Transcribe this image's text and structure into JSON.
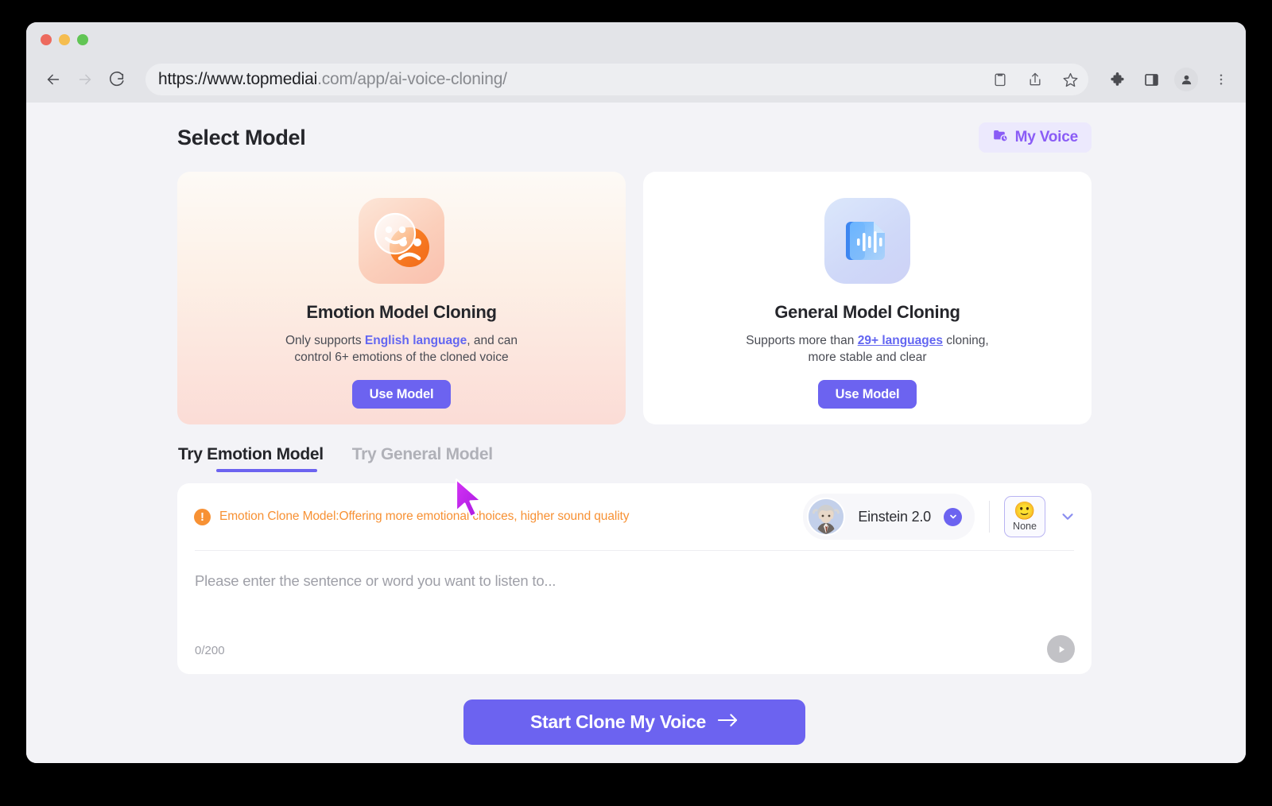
{
  "browser": {
    "url_bold": "https://www.topmediai",
    "url_rest": ".com/app/ai-voice-cloning/",
    "nav": {
      "back": "back-arrow",
      "forward": "forward-arrow",
      "reload": "reload-icon"
    },
    "toolbar_icons": [
      "clipboard-icon",
      "share-icon",
      "bookmark-star-icon",
      "extensions-puzzle-icon",
      "side-panel-icon",
      "profile-icon",
      "more-menu-icon"
    ],
    "window_controls": [
      "close",
      "minimize",
      "maximize"
    ]
  },
  "header": {
    "title": "Select Model",
    "my_voice_label": "My Voice"
  },
  "cards": [
    {
      "id": "emotion",
      "icon": "emotion-faces-icon",
      "title": "Emotion Model Cloning",
      "desc_pre": "Only supports ",
      "desc_highlight": "English language",
      "desc_post": ", and can control 6+ emotions of the cloned voice",
      "button": "Use Model"
    },
    {
      "id": "general",
      "icon": "waveform-document-icon",
      "title": "General Model Cloning",
      "desc_pre": "Supports more than ",
      "desc_highlight": "29+ languages",
      "desc_post": " cloning, more stable and clear",
      "button": "Use Model"
    }
  ],
  "tabs": [
    {
      "prefix": "Try",
      "name": "Emotion Model",
      "active": true
    },
    {
      "prefix": "Try",
      "name": "General Model",
      "active": false
    }
  ],
  "panel": {
    "notice": "Emotion Clone Model:Offering more emotional choices, higher sound quality",
    "notice_icon": "exclamation-circle-icon",
    "voice_name": "Einstein 2.0",
    "emotion_face": "🙂",
    "emotion_label": "None",
    "placeholder": "Please enter the sentence or word you want to listen to...",
    "counter": "0/200",
    "play_icon": "play-icon"
  },
  "cta": {
    "label": "Start Clone My Voice",
    "arrow": "→"
  },
  "colors": {
    "accent_purple": "#6c63f0",
    "my_voice_purple": "#8a5cf6",
    "notice_orange": "#f79134",
    "page_bg": "#f3f3f7",
    "cursor": "#c026f0"
  }
}
